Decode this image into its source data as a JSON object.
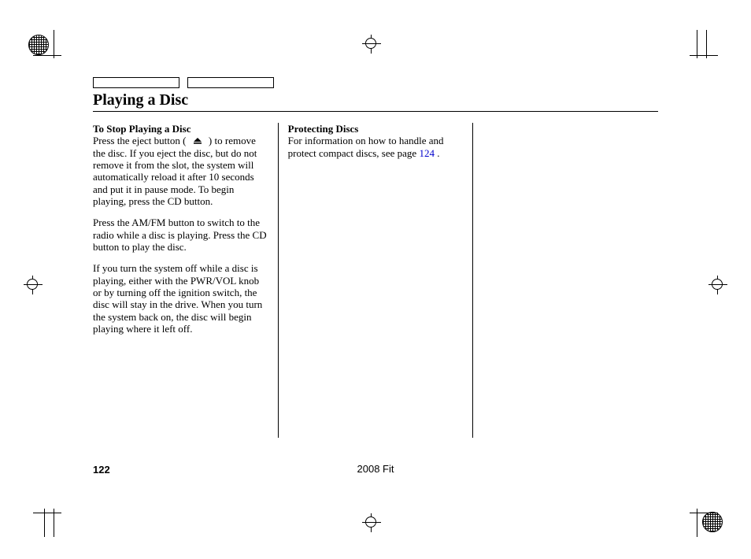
{
  "title": "Playing a Disc",
  "col1": {
    "heading": "To Stop Playing a Disc",
    "p1a": "Press the eject button (",
    "p1b": ") to remove the disc. If you eject the disc, but do not remove it from the slot, the system will automatically reload it after 10 seconds and put it in pause mode. To begin playing, press the CD button.",
    "p2": "Press the AM/FM button to switch to the radio while a disc is playing. Press the CD button to play the disc.",
    "p3": "If you turn the system off while a disc is playing, either with the PWR/VOL knob or by turning off the ignition switch, the disc will stay in the drive. When you turn the system back on, the disc will begin playing where it left off."
  },
  "col2": {
    "heading": "Protecting Discs",
    "p1a": "For information on how to handle and protect compact discs, see page",
    "link": "124",
    "p1b": "."
  },
  "footer": {
    "page": "122",
    "model": "2008  Fit"
  }
}
